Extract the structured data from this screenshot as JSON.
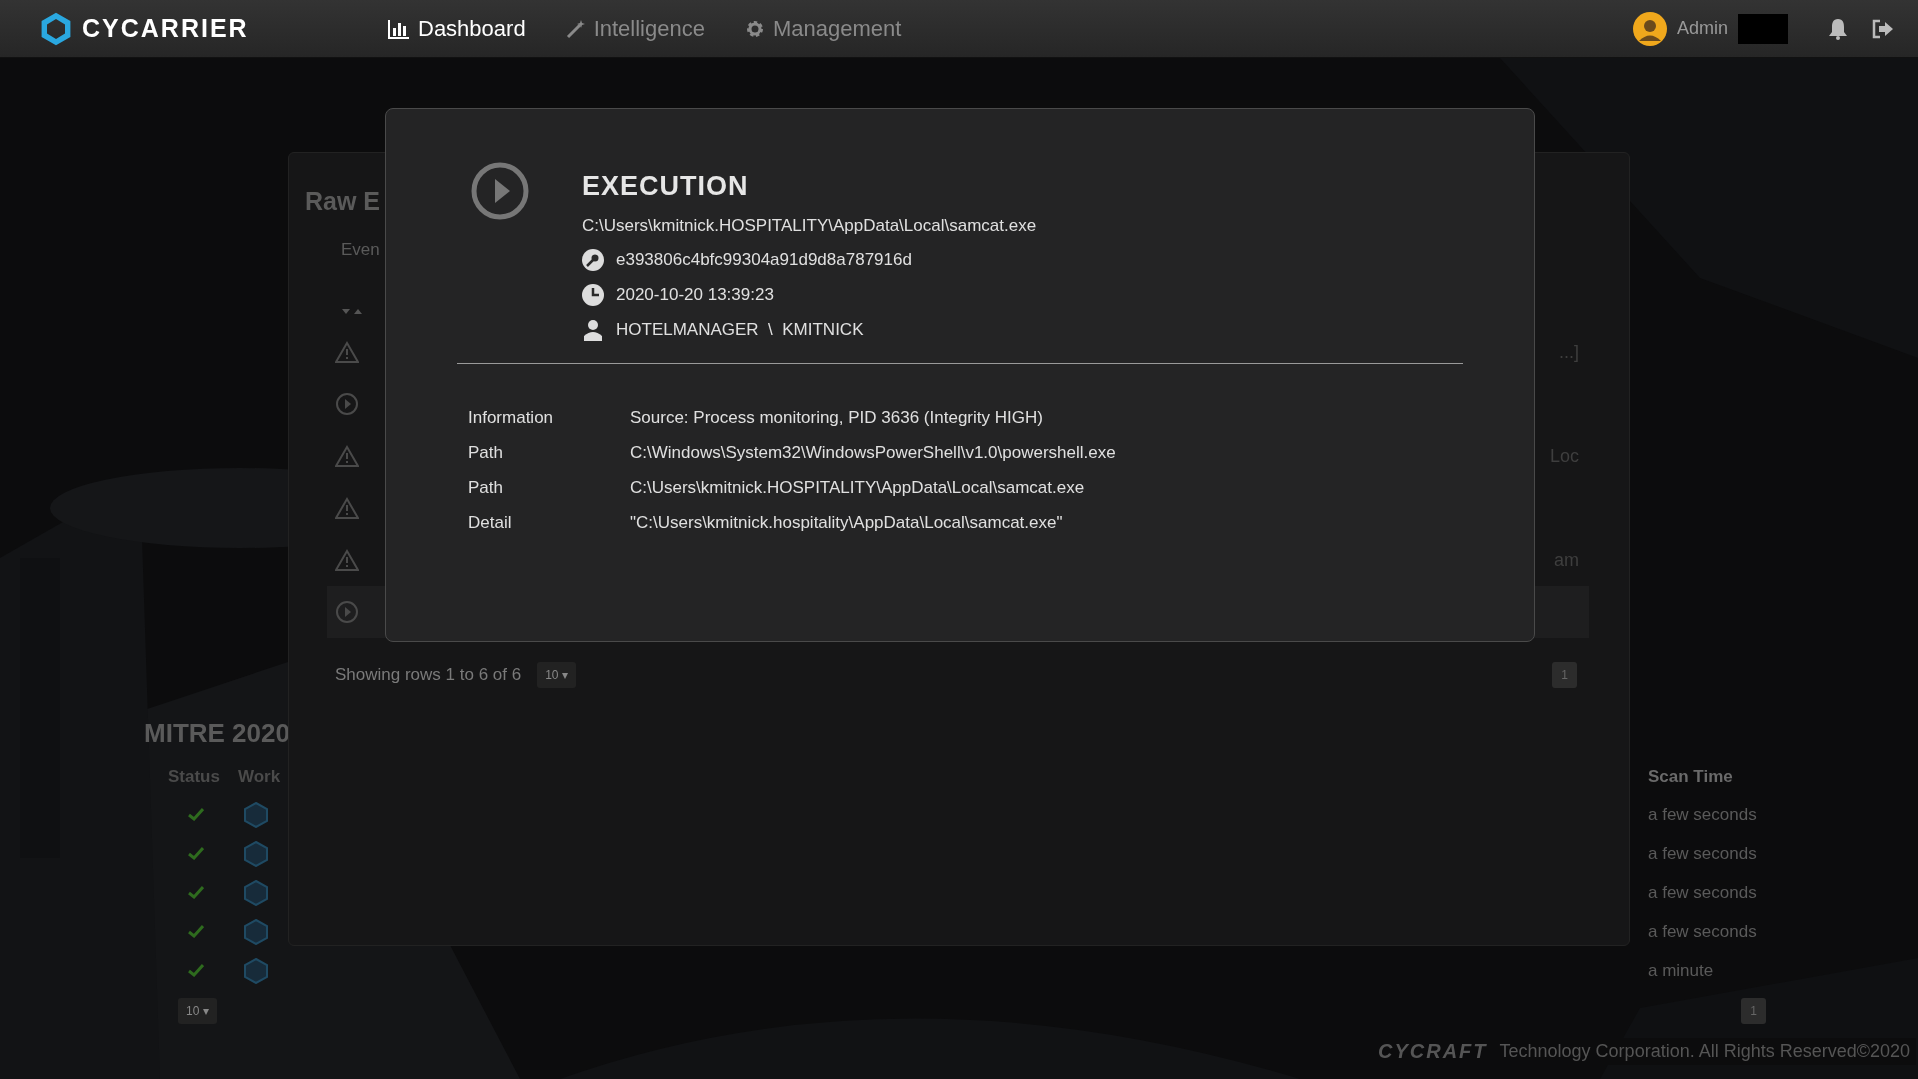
{
  "navbar": {
    "brand": "CYCARRIER",
    "items": [
      {
        "label": "Dashboard",
        "kind": "chart",
        "selected": true
      },
      {
        "label": "Intelligence",
        "kind": "wand",
        "selected": false
      },
      {
        "label": "Management",
        "kind": "gear",
        "selected": false
      }
    ],
    "user": {
      "name": "Admin"
    }
  },
  "raw_events": {
    "title": "Raw E",
    "filter_label": "Even",
    "rows": [
      {
        "kind": "warning",
        "tail": "...]"
      },
      {
        "kind": "play"
      },
      {
        "kind": "warning",
        "tail": "Loc"
      },
      {
        "kind": "warning"
      },
      {
        "kind": "warning",
        "tail": "am"
      },
      {
        "kind": "play"
      }
    ],
    "summary": "Showing rows 1 to 6 of 6",
    "page_size": "10 ▾",
    "page": "1"
  },
  "mitre": {
    "title": "MITRE 2020",
    "columns": [
      "Status",
      "Work",
      "Scan Time"
    ],
    "rows": [
      {
        "scan_time": "a few seconds"
      },
      {
        "scan_time": "a few seconds"
      },
      {
        "scan_time": "a few seconds"
      },
      {
        "scan_time": "a few seconds"
      },
      {
        "scan_time": "a minute"
      }
    ],
    "page_size": "10 ▾",
    "page": "1"
  },
  "modal": {
    "kind": "play",
    "title": "EXECUTION",
    "path": "C:\\Users\\kmitnick.HOSPITALITY\\AppData\\Local\\samcat.exe",
    "facts": [
      {
        "kind": "key",
        "text": "e393806c4bfc99304a91d9d8a787916d"
      },
      {
        "kind": "clock",
        "text": "2020-10-20 13:39:23"
      },
      {
        "kind": "user",
        "text": "HOTELMANAGER  \\  KMITNICK"
      }
    ],
    "details": [
      {
        "label": "Information",
        "value": "Source: Process monitoring, PID 3636 (Integrity HIGH)"
      },
      {
        "label": "Path",
        "value": "C:\\Windows\\System32\\WindowsPowerShell\\v1.0\\powershell.exe"
      },
      {
        "label": "Path",
        "value": "C:\\Users\\kmitnick.HOSPITALITY\\AppData\\Local\\samcat.exe"
      },
      {
        "label": "Detail",
        "value": "\"C:\\Users\\kmitnick.hospitality\\AppData\\Local\\samcat.exe\""
      }
    ]
  },
  "footer": {
    "logo": "CYCRAFT",
    "text": "Technology Corporation. All Rights Reserved©2020"
  }
}
